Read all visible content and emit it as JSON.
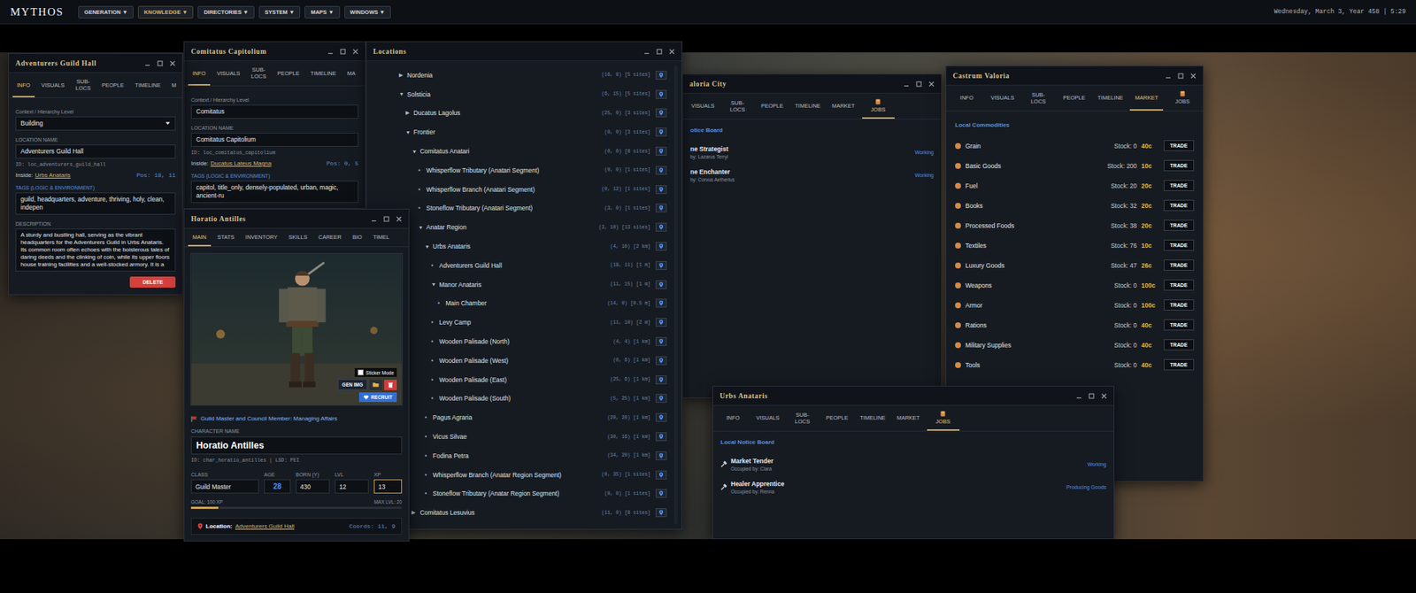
{
  "topbar": {
    "logo": "MYTHOS",
    "menus": [
      {
        "label": "GENERATION ▼",
        "selected": false
      },
      {
        "label": "KNOWLEDGE ▼",
        "selected": true
      },
      {
        "label": "DIRECTORIES ▼",
        "selected": false
      },
      {
        "label": "SYSTEM ▼",
        "selected": false
      },
      {
        "label": "MAPS ▼",
        "selected": false
      },
      {
        "label": "WINDOWS ▼",
        "selected": false
      }
    ],
    "clock": "Wednesday, March 3, Year 458 | 5:29"
  },
  "guild_hall": {
    "title": "Adventurers Guild Hall",
    "tabs": [
      {
        "label": "INFO",
        "selected": true
      },
      {
        "label": "VISUALS",
        "selected": false
      },
      {
        "label": "SUB-LOCS",
        "selected": false
      },
      {
        "label": "PEOPLE",
        "selected": false
      },
      {
        "label": "TIMELINE",
        "selected": false
      },
      {
        "label": "M",
        "selected": false
      }
    ],
    "context_label": "Context / Hierarchy Level",
    "context": "Building",
    "name_label": "LOCATION NAME",
    "name": "Adventurers Guild Hall",
    "id": "ID: loc_adventurers_guild_hall",
    "inside_label": "Inside:",
    "inside": "Urbs Anataris",
    "pos": "Pos: 18, 11",
    "tags_label": "TAGS (LOGIC & ENVIRONMENT)",
    "tags": "guild, headquarters, adventure, thriving, holy, clean, indepen",
    "desc_label": "DESCRIPTION",
    "description": "A sturdy and bustling hall, serving as the vibrant headquarters for the Adventurers Guild in Urbs Anataris. Its common room often echoes with the boisterous tales of daring deeds and the clinking of coin, while its upper floors house training facilities and a well-stocked armory. It is a",
    "delete": "DELETE"
  },
  "comitatus": {
    "title": "Comitatus Capitolium",
    "tabs": [
      {
        "label": "INFO",
        "selected": true
      },
      {
        "label": "VISUALS",
        "selected": false
      },
      {
        "label": "SUB-LOCS",
        "selected": false
      },
      {
        "label": "PEOPLE",
        "selected": false
      },
      {
        "label": "TIMELINE",
        "selected": false
      },
      {
        "label": "MA",
        "selected": false
      }
    ],
    "context_label": "Context / Hierarchy Level",
    "context": "Comitatus",
    "name_label": "LOCATION NAME",
    "name": "Comitatus Capitolium",
    "id": "ID: loc_comitatus_capitolium",
    "inside_label": "Inside:",
    "inside": "Ducatus Lateus Magna",
    "pos": "Pos: 0, 5",
    "tags_label": "TAGS (LOGIC & ENVIRONMENT)",
    "tags": "capitol, title_only, densely-populated, urban, magic, ancient-ru"
  },
  "locations": {
    "title": "Locations",
    "tree": [
      {
        "kind": "closed",
        "toggle": "▶",
        "name": "Nordenia",
        "coords": "(16, 8)",
        "size": "[5 sites]"
      },
      {
        "kind": "open",
        "toggle": "▼",
        "name": "Solsticia",
        "coords": "(6, 15)",
        "size": "[5 sites]",
        "children": [
          {
            "kind": "closed",
            "toggle": "▶",
            "name": "Ducatus Lagolus",
            "coords": "(25, 0)",
            "size": "[3 sites]"
          },
          {
            "kind": "open",
            "toggle": "▼",
            "name": "Frontier",
            "coords": "(0, 0)",
            "size": "[3 sites]",
            "children": [
              {
                "kind": "open",
                "toggle": "▼",
                "name": "Comitatus Anatari",
                "coords": "(0, 0)",
                "size": "[8 sites]",
                "children": [
                  {
                    "kind": "leaf",
                    "toggle": "•",
                    "name": "Whisperflow Tributary (Anatari Segment)",
                    "coords": "(0, 0)",
                    "size": "[1 sites]"
                  },
                  {
                    "kind": "leaf",
                    "toggle": "•",
                    "name": "Whisperflow Branch (Anatari Segment)",
                    "coords": "(0, 12)",
                    "size": "[1 sites]"
                  },
                  {
                    "kind": "leaf",
                    "toggle": "•",
                    "name": "Stoneflow Tributary (Anatari Segment)",
                    "coords": "(3, 0)",
                    "size": "[1 sites]"
                  },
                  {
                    "kind": "open",
                    "toggle": "▼",
                    "name": "Anatar Region",
                    "coords": "(3, 10)",
                    "size": "[13 sites]",
                    "children": [
                      {
                        "kind": "open",
                        "toggle": "▼",
                        "name": "Urbs Anataris",
                        "coords": "(4, 10)",
                        "size": "[2 km]",
                        "children": [
                          {
                            "kind": "leaf",
                            "toggle": "•",
                            "name": "Adventurers Guild Hall",
                            "coords": "(18, 11)",
                            "size": "[1 m]"
                          },
                          {
                            "kind": "open",
                            "toggle": "▼",
                            "name": "Manor Anataris",
                            "coords": "(11, 15)",
                            "size": "[1 m]",
                            "children": [
                              {
                                "kind": "leaf",
                                "toggle": "•",
                                "name": "Main Chamber",
                                "coords": "(14, 0)",
                                "size": "[0.5 m]"
                              }
                            ]
                          },
                          {
                            "kind": "leaf",
                            "toggle": "•",
                            "name": "Levy Camp",
                            "coords": "(11, 10)",
                            "size": "[2 m]"
                          },
                          {
                            "kind": "leaf",
                            "toggle": "•",
                            "name": "Wooden Palisade (North)",
                            "coords": "(4, 4)",
                            "size": "[1 km]"
                          },
                          {
                            "kind": "leaf",
                            "toggle": "•",
                            "name": "Wooden Palisade (West)",
                            "coords": "(0, 6)",
                            "size": "[1 km]"
                          },
                          {
                            "kind": "leaf",
                            "toggle": "•",
                            "name": "Wooden Palisade (East)",
                            "coords": "(25, 6)",
                            "size": "[1 km]"
                          },
                          {
                            "kind": "leaf",
                            "toggle": "•",
                            "name": "Wooden Palisade (South)",
                            "coords": "(5, 25)",
                            "size": "[1 km]"
                          }
                        ]
                      },
                      {
                        "kind": "leaf",
                        "toggle": "•",
                        "name": "Pagus Agraria",
                        "coords": "(20, 20)",
                        "size": "[1 km]"
                      },
                      {
                        "kind": "leaf",
                        "toggle": "•",
                        "name": "Vicus Silvae",
                        "coords": "(30, 16)",
                        "size": "[1 km]"
                      },
                      {
                        "kind": "leaf",
                        "toggle": "•",
                        "name": "Fodina Petra",
                        "coords": "(34, 20)",
                        "size": "[1 km]"
                      },
                      {
                        "kind": "leaf",
                        "toggle": "•",
                        "name": "Whisperflow Branch (Anatar Region Segment)",
                        "coords": "(0, 35)",
                        "size": "[1 sites]"
                      },
                      {
                        "kind": "leaf",
                        "toggle": "•",
                        "name": "Stoneflow Tributary (Anatar Region Segment)",
                        "coords": "(0, 0)",
                        "size": "[1 sites]"
                      }
                    ]
                  }
                ]
              },
              {
                "kind": "closed",
                "toggle": "▶",
                "name": "Comitatus Lesuvius",
                "coords": "(11, 0)",
                "size": "[8 sites]"
              }
            ]
          }
        ]
      }
    ]
  },
  "horatio": {
    "title": "Horatio Antilles",
    "tabs": [
      {
        "label": "MAIN",
        "selected": true
      },
      {
        "label": "STATS",
        "selected": false
      },
      {
        "label": "INVENTORY",
        "selected": false
      },
      {
        "label": "SKILLS",
        "selected": false
      },
      {
        "label": "CAREER",
        "selected": false
      },
      {
        "label": "BIO",
        "selected": false
      },
      {
        "label": "TIMEL",
        "selected": false
      }
    ],
    "sticker_label": "Sticker Mode",
    "sticker": false,
    "gen_img": "GEN IMG",
    "recruit": "RECRUIT",
    "role": "Guild Master and Council Member: Managing Affairs",
    "name_label": "CHARACTER NAME",
    "name": "Horatio Antilles",
    "id": "ID: char_horatio_antilles | LSD: PEI",
    "stats": [
      {
        "label": "CLASS",
        "value": "Guild Master",
        "kind": "plain"
      },
      {
        "label": "AGE",
        "value": "28",
        "kind": "blue"
      },
      {
        "label": "BORN (Y)",
        "value": "430",
        "kind": "plain"
      },
      {
        "label": "LVL",
        "value": "12",
        "kind": "plain"
      },
      {
        "label": "XP",
        "value": "13",
        "kind": "gold"
      }
    ],
    "goal": "GOAL: 100 XP",
    "max": "MAX LVL: 20",
    "xp_level": 0.13,
    "location_label": "Location:",
    "location": "Adventurers Guild Hall",
    "coords": "Coords: 11, 9"
  },
  "valoria": {
    "title": "aloria City",
    "tabs": [
      {
        "label": "VISUALS",
        "selected": false,
        "kind": "plain"
      },
      {
        "label": "SUB-LOCS",
        "selected": false,
        "kind": "plain"
      },
      {
        "label": "PEOPLE",
        "selected": false,
        "kind": "plain"
      },
      {
        "label": "TIMELINE",
        "selected": false,
        "kind": "plain"
      },
      {
        "label": "MARKET",
        "selected": false,
        "kind": "plain"
      },
      {
        "label": "JOBS",
        "selected": true,
        "kind": "jobs"
      }
    ],
    "board": "otice Board",
    "jobs": [
      {
        "title": "ne Strategist",
        "by": "by: Lazarus Terryl",
        "status": "Working"
      },
      {
        "title": "ne Enchanter",
        "by": "by: Corvus Aetherius",
        "status": "Working"
      }
    ]
  },
  "castrum": {
    "title": "Castrum Valoria",
    "tabs": [
      {
        "label": "INFO",
        "selected": false,
        "kind": "plain"
      },
      {
        "label": "VISUALS",
        "selected": false,
        "kind": "plain"
      },
      {
        "label": "SUB-LOCS",
        "selected": false,
        "kind": "plain"
      },
      {
        "label": "PEOPLE",
        "selected": false,
        "kind": "plain"
      },
      {
        "label": "TIMELINE",
        "selected": false,
        "kind": "plain"
      },
      {
        "label": "MARKET",
        "selected": true,
        "kind": "plain"
      },
      {
        "label": "JOBS",
        "selected": false,
        "kind": "jobs"
      }
    ],
    "heading": "Local Commodities",
    "commodities": [
      {
        "name": "Grain",
        "stock": "Stock: 0",
        "price": "40c",
        "action": "TRADE"
      },
      {
        "name": "Basic Goods",
        "stock": "Stock: 200",
        "price": "10c",
        "action": "TRADE"
      },
      {
        "name": "Fuel",
        "stock": "Stock: 20",
        "price": "20c",
        "action": "TRADE"
      },
      {
        "name": "Books",
        "stock": "Stock: 32",
        "price": "20c",
        "action": "TRADE"
      },
      {
        "name": "Processed Foods",
        "stock": "Stock: 38",
        "price": "20c",
        "action": "TRADE"
      },
      {
        "name": "Textiles",
        "stock": "Stock: 76",
        "price": "10c",
        "action": "TRADE"
      },
      {
        "name": "Luxury Goods",
        "stock": "Stock: 47",
        "price": "26c",
        "action": "TRADE"
      },
      {
        "name": "Weapons",
        "stock": "Stock: 0",
        "price": "100c",
        "action": "TRADE"
      },
      {
        "name": "Armor",
        "stock": "Stock: 0",
        "price": "100c",
        "action": "TRADE"
      },
      {
        "name": "Rations",
        "stock": "Stock: 0",
        "price": "40c",
        "action": "TRADE"
      },
      {
        "name": "Military Supplies",
        "stock": "Stock: 0",
        "price": "40c",
        "action": "TRADE"
      },
      {
        "name": "Tools",
        "stock": "Stock: 0",
        "price": "40c",
        "action": "TRADE"
      }
    ]
  },
  "urbs": {
    "title": "Urbs Anataris",
    "tabs": [
      {
        "label": "INFO",
        "selected": false,
        "kind": "plain"
      },
      {
        "label": "VISUALS",
        "selected": false,
        "kind": "plain"
      },
      {
        "label": "SUB-LOCS",
        "selected": false,
        "kind": "plain"
      },
      {
        "label": "PEOPLE",
        "selected": false,
        "kind": "plain"
      },
      {
        "label": "TIMELINE",
        "selected": false,
        "kind": "plain"
      },
      {
        "label": "MARKET",
        "selected": false,
        "kind": "plain"
      },
      {
        "label": "JOBS",
        "selected": true,
        "kind": "jobs"
      }
    ],
    "board": "Local Notice Board",
    "jobs": [
      {
        "title": "Market Tender",
        "by": "Occupied by: Clara",
        "status": "Working"
      },
      {
        "title": "Healer Apprentice",
        "by": "Occupied by: Renna",
        "status": "Producing Goods"
      }
    ]
  }
}
